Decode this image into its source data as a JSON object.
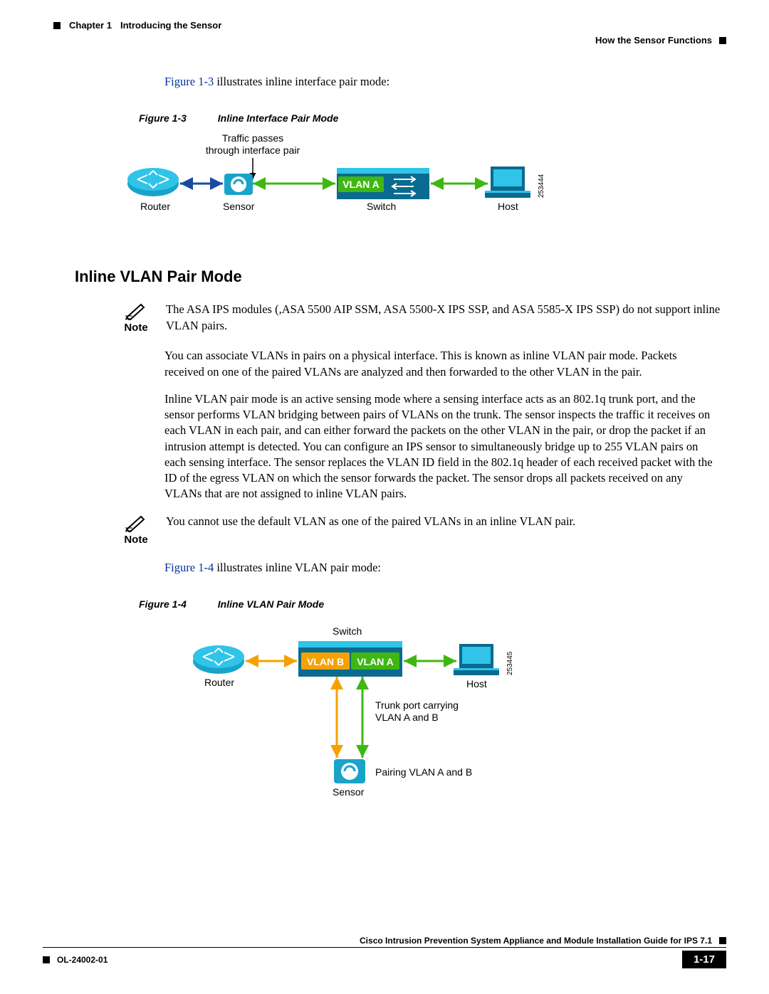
{
  "header": {
    "chapter": "Chapter 1",
    "chapterTitle": "Introducing the Sensor",
    "section": "How the Sensor Functions"
  },
  "intro": {
    "figref": "Figure 1-3",
    "text": " illustrates inline interface pair mode:"
  },
  "fig1": {
    "num": "Figure 1-3",
    "title": "Inline Interface Pair Mode",
    "trafficLabel1": "Traffic passes",
    "trafficLabel2": "through interface pair",
    "vlanA": "VLAN A",
    "router": "Router",
    "sensor": "Sensor",
    "switch": "Switch",
    "host": "Host",
    "imgnum": "253444"
  },
  "h2": "Inline VLAN Pair Mode",
  "note1": {
    "label": "Note",
    "text": "The ASA IPS modules (,ASA 5500 AIP SSM, ASA 5500-X IPS SSP, and ASA 5585-X IPS SSP) do not support inline VLAN pairs."
  },
  "paras": {
    "p1": "You can associate VLANs in pairs on a physical interface. This is known as inline VLAN pair mode. Packets received on one of the paired VLANs are analyzed and then forwarded to the other VLAN in the pair.",
    "p2": "Inline VLAN pair mode is an active sensing mode where a sensing interface acts as an 802.1q trunk port, and the sensor performs VLAN bridging between pairs of VLANs on the trunk. The sensor inspects the traffic it receives on each VLAN in each pair, and can either forward the packets on the other VLAN in the pair, or drop the packet if an intrusion attempt is detected. You can configure an IPS sensor to simultaneously bridge up to 255 VLAN pairs on each sensing interface. The sensor replaces the VLAN ID field in the 802.1q header of each received packet with the ID of the egress VLAN on which the sensor forwards the packet. The sensor drops all packets received on any VLANs that are not assigned to inline VLAN pairs."
  },
  "note2": {
    "label": "Note",
    "text": "You cannot use the default VLAN as one of the paired VLANs in an inline VLAN pair."
  },
  "intro2": {
    "figref": "Figure 1-4",
    "text": " illustrates inline VLAN pair mode:"
  },
  "fig2": {
    "num": "Figure 1-4",
    "title": "Inline VLAN Pair Mode",
    "switch": "Switch",
    "vlanB": "VLAN B",
    "vlanA": "VLAN A",
    "router": "Router",
    "host": "Host",
    "trunk1": "Trunk port carrying",
    "trunk2": "VLAN A and B",
    "pairing": "Pairing VLAN A and B",
    "sensor": "Sensor",
    "imgnum": "253445"
  },
  "footer": {
    "guide": "Cisco Intrusion Prevention System Appliance and Module Installation Guide for IPS 7.1",
    "ol": "OL-24002-01",
    "pagenum": "1-17"
  }
}
